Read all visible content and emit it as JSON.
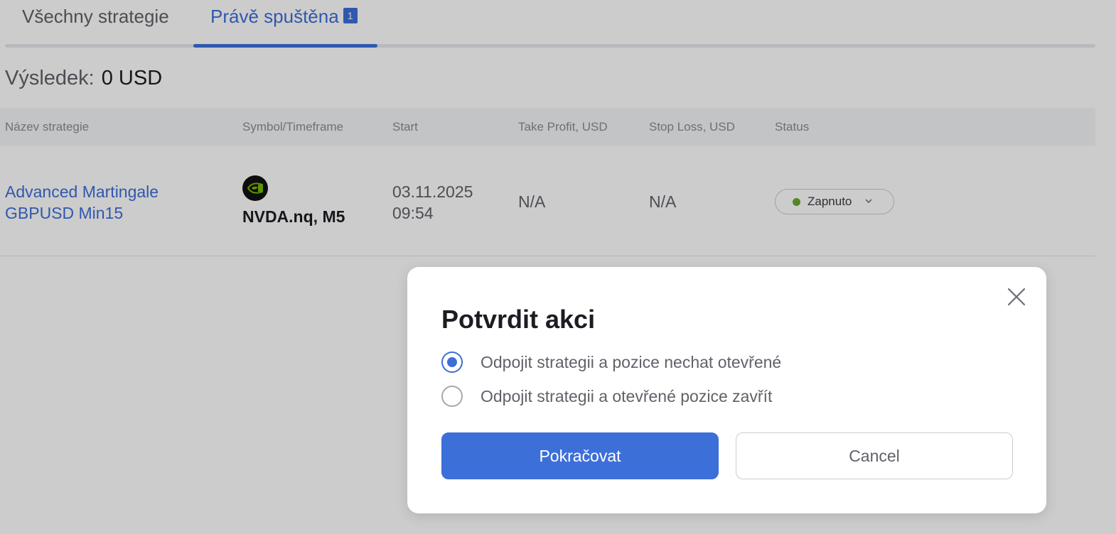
{
  "tabs": {
    "all_label": "Všechny strategie",
    "running_label": "Právě spuštěna",
    "running_count": "1"
  },
  "result": {
    "label": "Výsledek:",
    "value": "0 USD"
  },
  "table": {
    "headers": {
      "name": "Název strategie",
      "symbol": "Symbol/Timeframe",
      "start": "Start",
      "take_profit": "Take Profit, USD",
      "stop_loss": "Stop Loss, USD",
      "status": "Status"
    },
    "rows": [
      {
        "name_line1": "Advanced Martingale",
        "name_line2": "GBPUSD Min15",
        "symbol": "NVDA.nq, M5",
        "start_date": "03.11.2025",
        "start_time": "09:54",
        "take_profit": "N/A",
        "stop_loss": "N/A",
        "status": "Zapnuto",
        "status_color": "#6aa82e"
      }
    ]
  },
  "modal": {
    "title": "Potvrdit akci",
    "options": [
      {
        "label": "Odpojit strategii a pozice nechat otevřené",
        "checked": true
      },
      {
        "label": "Odpojit strategii a otevřené pozice zavřít",
        "checked": false
      }
    ],
    "confirm_label": "Pokračovat",
    "cancel_label": "Cancel"
  },
  "colors": {
    "accent": "#3d6fd9",
    "status_on": "#6aa82e"
  },
  "icons": {
    "symbol_logo": "nvidia-logo-icon",
    "status_dropdown": "chevron-down-icon",
    "close": "close-icon"
  }
}
